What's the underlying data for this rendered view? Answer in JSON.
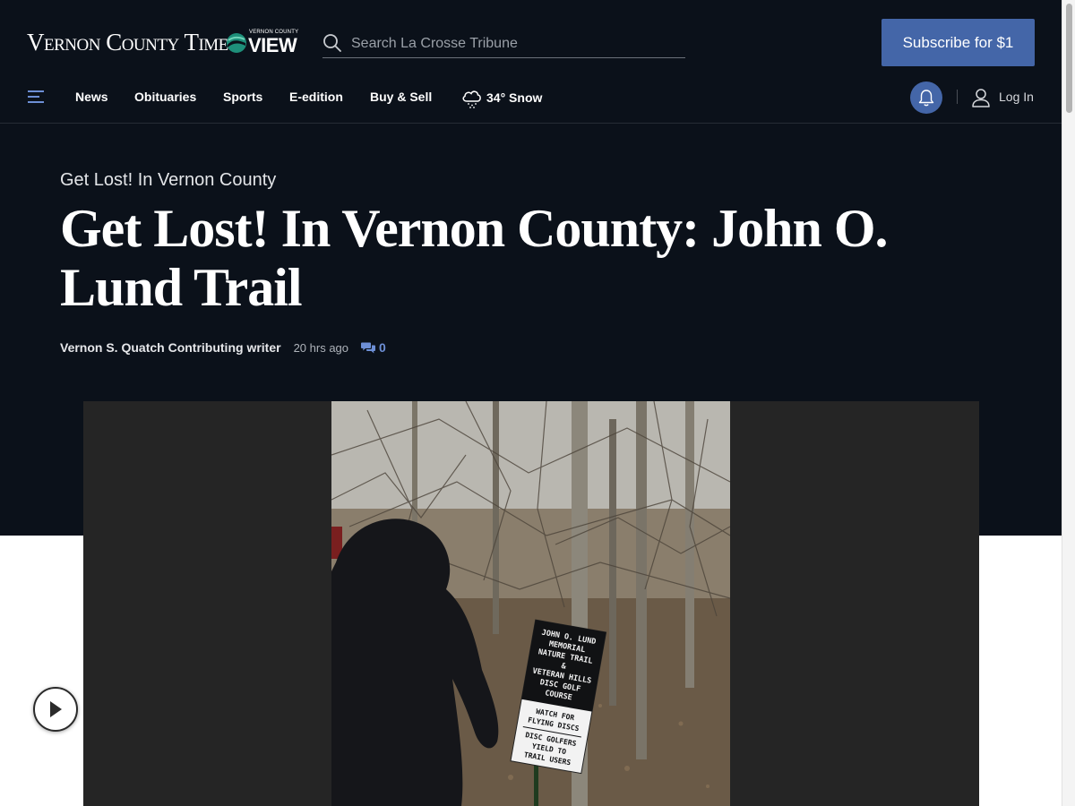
{
  "header": {
    "logo_text": "Vernon County Times",
    "partner_logo_small": "VERNON COUNTY",
    "partner_logo_big": "VIEW",
    "search_placeholder": "Search La Crosse Tribune",
    "subscribe_label": "Subscribe for $1"
  },
  "nav": {
    "items": [
      {
        "label": "News"
      },
      {
        "label": "Obituaries"
      },
      {
        "label": "Sports"
      },
      {
        "label": "E-edition"
      },
      {
        "label": "Buy & Sell"
      }
    ],
    "weather": "34° Snow",
    "login_label": "Log In",
    "icons": [
      "menu-icon",
      "weather-snow-icon",
      "bell-icon",
      "user-icon",
      "search-icon"
    ]
  },
  "article": {
    "kicker": "Get Lost! In Vernon County",
    "headline": "Get Lost! In Vernon County: John O. Lund Trail",
    "author": "Vernon S. Quatch Contributing writer",
    "time": "20 hrs ago",
    "comment_count": "0"
  },
  "photo": {
    "sign_lines": [
      "JOHN O. LUND",
      "MEMORIAL",
      "NATURE TRAIL",
      "&",
      "VETERAN HILLS",
      "DISC GOLF",
      "COURSE"
    ],
    "warning_lines": [
      "WATCH FOR",
      "FLYING DISCS"
    ],
    "yield_lines": [
      "DISC GOLFERS",
      "YIELD TO",
      "TRAIL USERS"
    ]
  },
  "colors": {
    "header_bg": "#0b111a",
    "accent": "#4466a8",
    "comment_accent": "#6d8fd6",
    "media_bg": "#252525"
  }
}
